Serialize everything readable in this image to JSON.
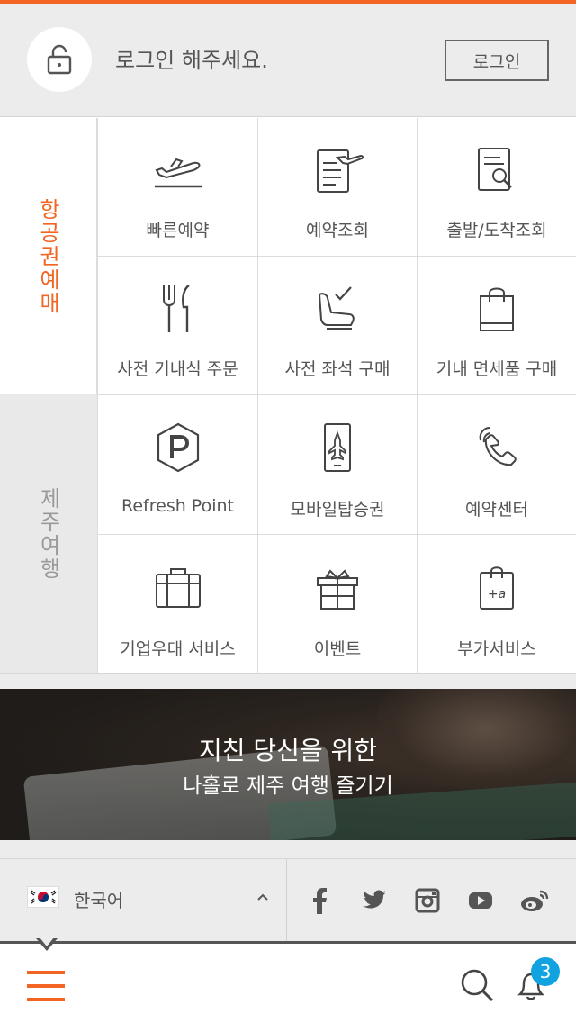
{
  "login": {
    "message": "로그인 해주세요.",
    "button_label": "로그인"
  },
  "sections": {
    "air": {
      "label": "항공권예매",
      "items": [
        {
          "label": "빠른예약",
          "icon": "airplane-takeoff-icon"
        },
        {
          "label": "예약조회",
          "icon": "reservation-document-icon"
        },
        {
          "label": "출발/도착조회",
          "icon": "document-search-icon"
        },
        {
          "label": "사전 기내식 주문",
          "icon": "fork-knife-icon"
        },
        {
          "label": "사전 좌석 구매",
          "icon": "seat-check-icon"
        },
        {
          "label": "기내 면세품 구매",
          "icon": "shopping-bag-icon"
        }
      ]
    },
    "jeju": {
      "label": "제주여행",
      "items": [
        {
          "label": "Refresh Point",
          "icon": "point-hexagon-icon"
        },
        {
          "label": "모바일탑승권",
          "icon": "mobile-boarding-pass-icon"
        },
        {
          "label": "예약센터",
          "icon": "phone-icon"
        },
        {
          "label": "기업우대 서비스",
          "icon": "briefcase-icon"
        },
        {
          "label": "이벤트",
          "icon": "gift-icon"
        },
        {
          "label": "부가서비스",
          "icon": "add-service-bag-icon"
        }
      ]
    }
  },
  "banner": {
    "line1": "지친 당신을 위한",
    "line2": "나홀로 제주 여행 즐기기"
  },
  "footer": {
    "language": "한국어",
    "social": [
      "facebook-icon",
      "twitter-icon",
      "instagram-icon",
      "youtube-icon",
      "weibo-icon"
    ]
  },
  "nav": {
    "notification_count": "3"
  },
  "colors": {
    "accent": "#f26522",
    "badge": "#11a3e0",
    "background": "#ececec"
  }
}
